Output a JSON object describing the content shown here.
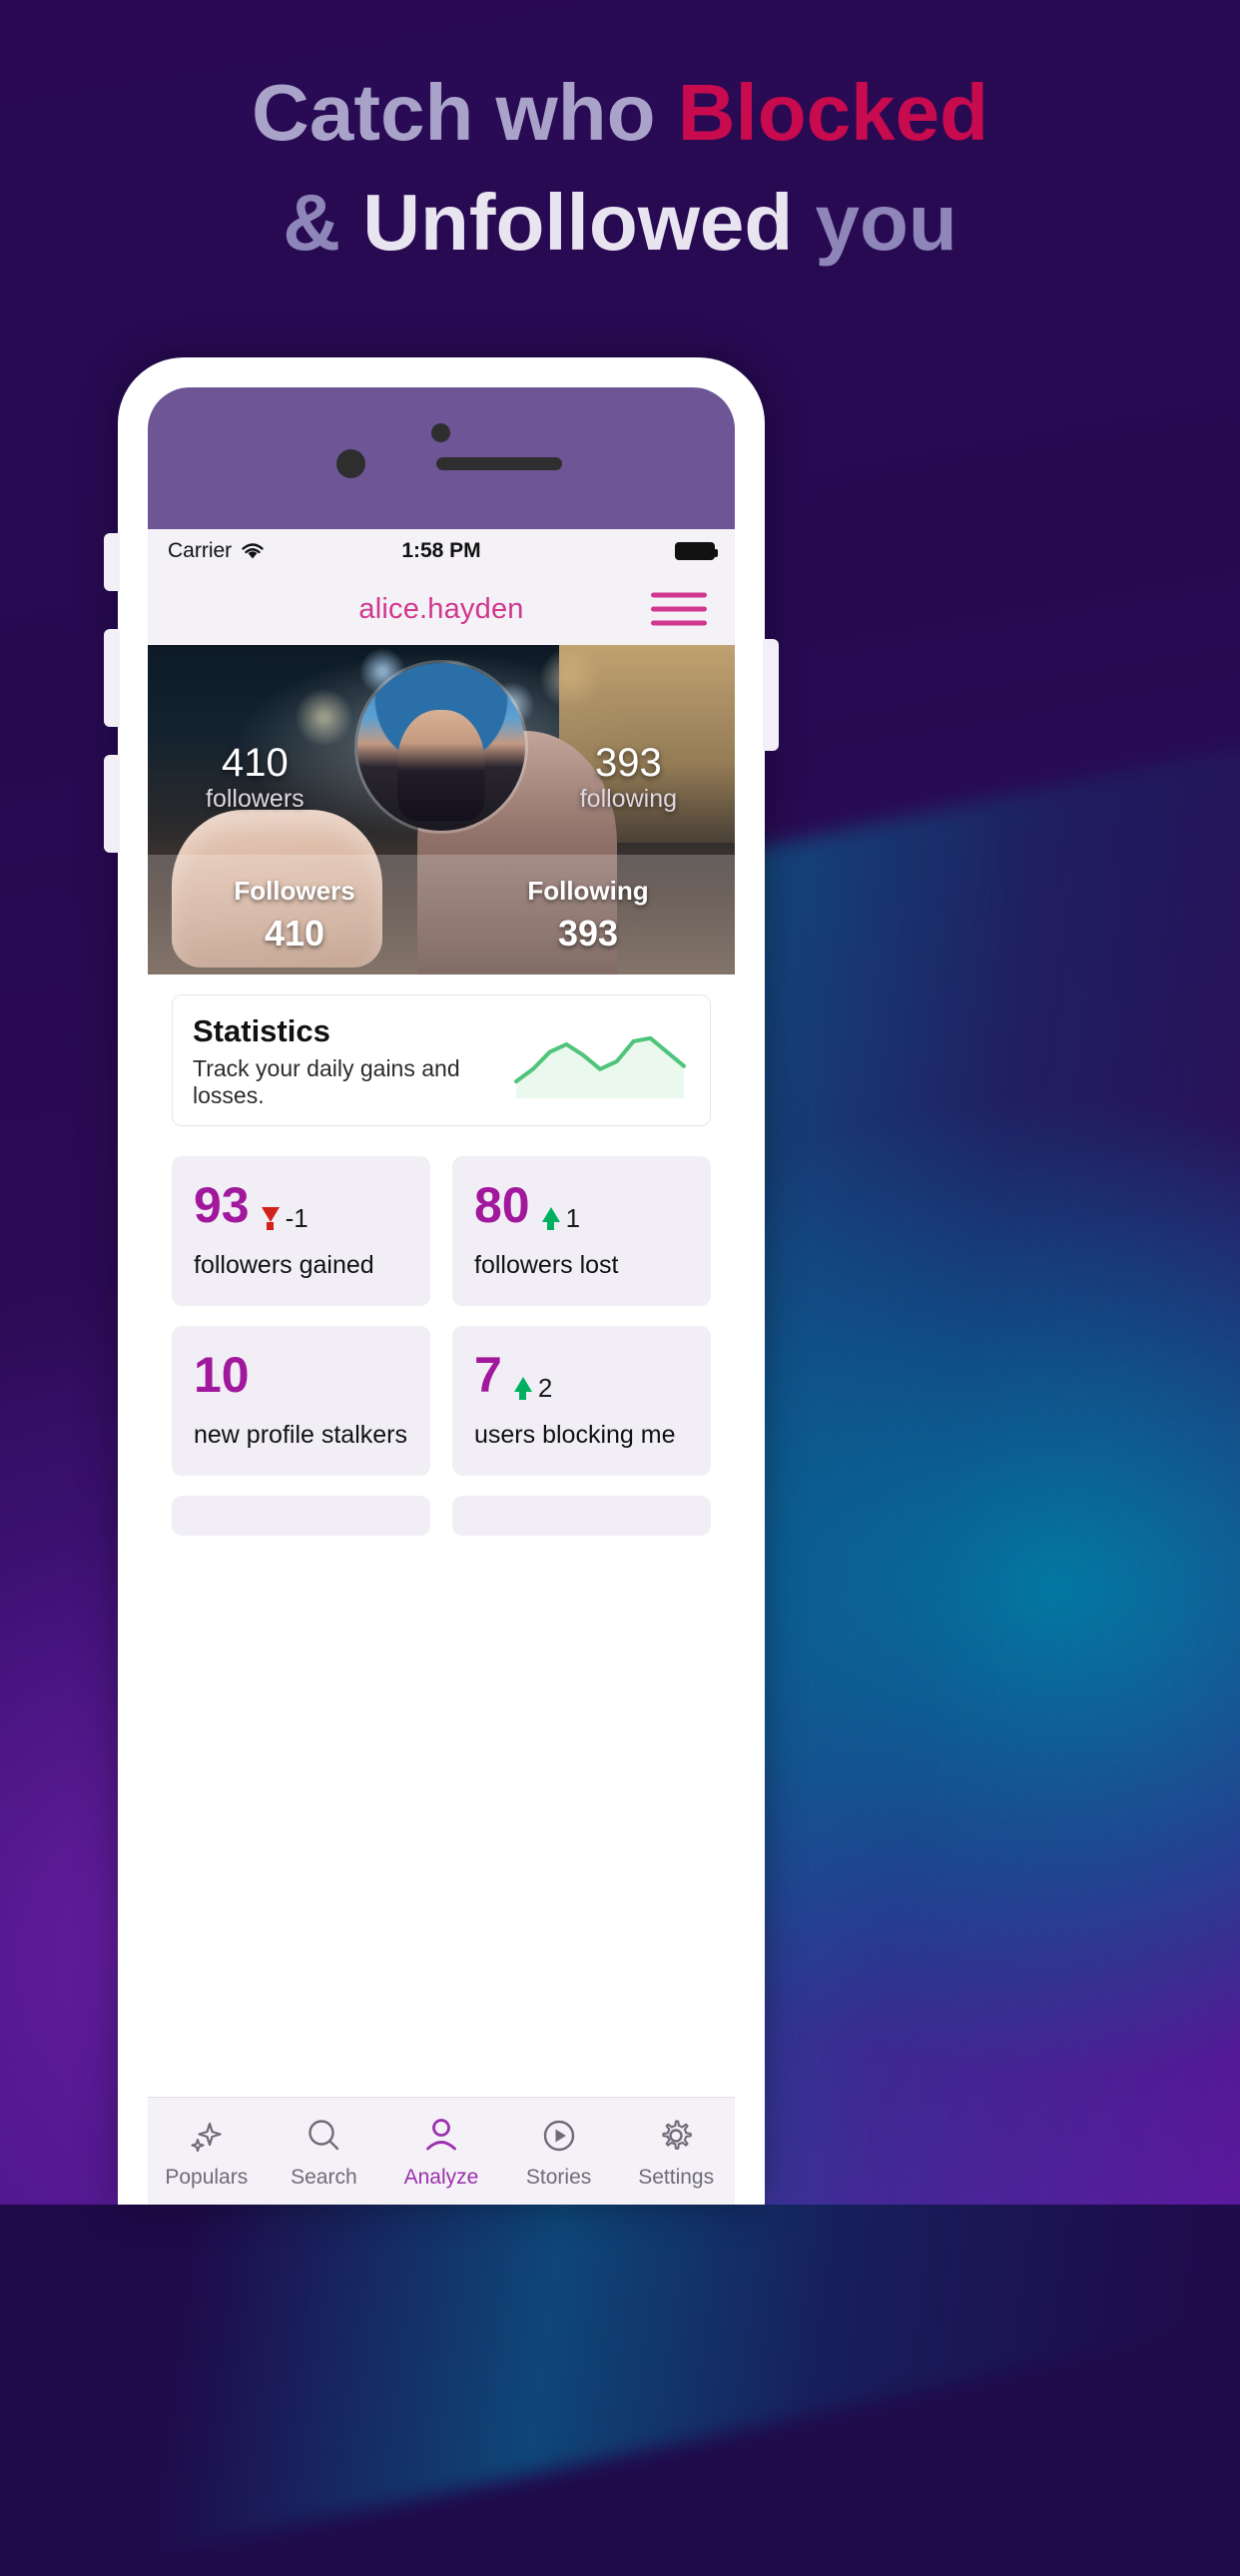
{
  "headline": {
    "line1_part1": "Catch who ",
    "line1_part2": "Blocked",
    "line2_part1": "& ",
    "line2_part2": "Unfollowed",
    "line2_part3": " you"
  },
  "colors": {
    "accent_pink": "#c80a4e",
    "headline_soft": "#a9a2c9",
    "headline_white": "#e8e4f0",
    "app_magenta": "#a1189c",
    "username_pink": "#d0378d",
    "tab_active": "#9b2fae",
    "up_arrow": "#00b060",
    "down_arrow": "#d4201a",
    "card_bg": "#f1eff5",
    "chrome_bg": "#f4f2f7"
  },
  "status_bar": {
    "carrier": "Carrier",
    "wifi_icon": "wifi-icon",
    "time": "1:58 PM",
    "battery_icon": "battery-full-icon"
  },
  "navbar": {
    "username": "alice.hayden",
    "menu_icon": "hamburger-menu-icon"
  },
  "hero": {
    "followers_count": "410",
    "followers_label": "followers",
    "following_count": "393",
    "following_label": "following",
    "bottom": {
      "followers_title": "Followers",
      "followers_value": "410",
      "following_title": "Following",
      "following_value": "393"
    }
  },
  "statistics_card": {
    "title": "Statistics",
    "subtitle": "Track your daily gains and losses."
  },
  "chart_data": {
    "type": "line",
    "title": "Statistics",
    "x": [
      0,
      1,
      2,
      3,
      4,
      5,
      6,
      7,
      8,
      9,
      10
    ],
    "values": [
      14,
      30,
      52,
      62,
      48,
      30,
      40,
      66,
      70,
      52,
      34
    ],
    "series": [
      {
        "name": "daily gains",
        "values": [
          14,
          30,
          52,
          62,
          48,
          30,
          40,
          66,
          70,
          52,
          34
        ]
      }
    ],
    "xlabel": "",
    "ylabel": "",
    "ylim": [
      0,
      80
    ],
    "grid": false,
    "legend": "none",
    "line_color": "#4fc47a",
    "fill_color": "#eaf8ee"
  },
  "stats": [
    {
      "value": "93",
      "delta": "-1",
      "delta_direction": "down",
      "delta_icon": "arrow-down-icon",
      "label": "followers gained"
    },
    {
      "value": "80",
      "delta": "1",
      "delta_direction": "up",
      "delta_icon": "arrow-up-icon",
      "label": "followers lost"
    },
    {
      "value": "10",
      "delta": "",
      "delta_direction": "none",
      "delta_icon": "",
      "label": "new profile stalkers"
    },
    {
      "value": "7",
      "delta": "2",
      "delta_direction": "up",
      "delta_icon": "arrow-up-icon",
      "label": "users blocking me"
    }
  ],
  "tabbar": {
    "items": [
      {
        "label": "Populars",
        "icon": "sparkles-icon",
        "active": false
      },
      {
        "label": "Search",
        "icon": "search-icon",
        "active": false
      },
      {
        "label": "Analyze",
        "icon": "person-icon",
        "active": true
      },
      {
        "label": "Stories",
        "icon": "play-circle-icon",
        "active": false
      },
      {
        "label": "Settings",
        "icon": "gear-icon",
        "active": false
      }
    ]
  }
}
